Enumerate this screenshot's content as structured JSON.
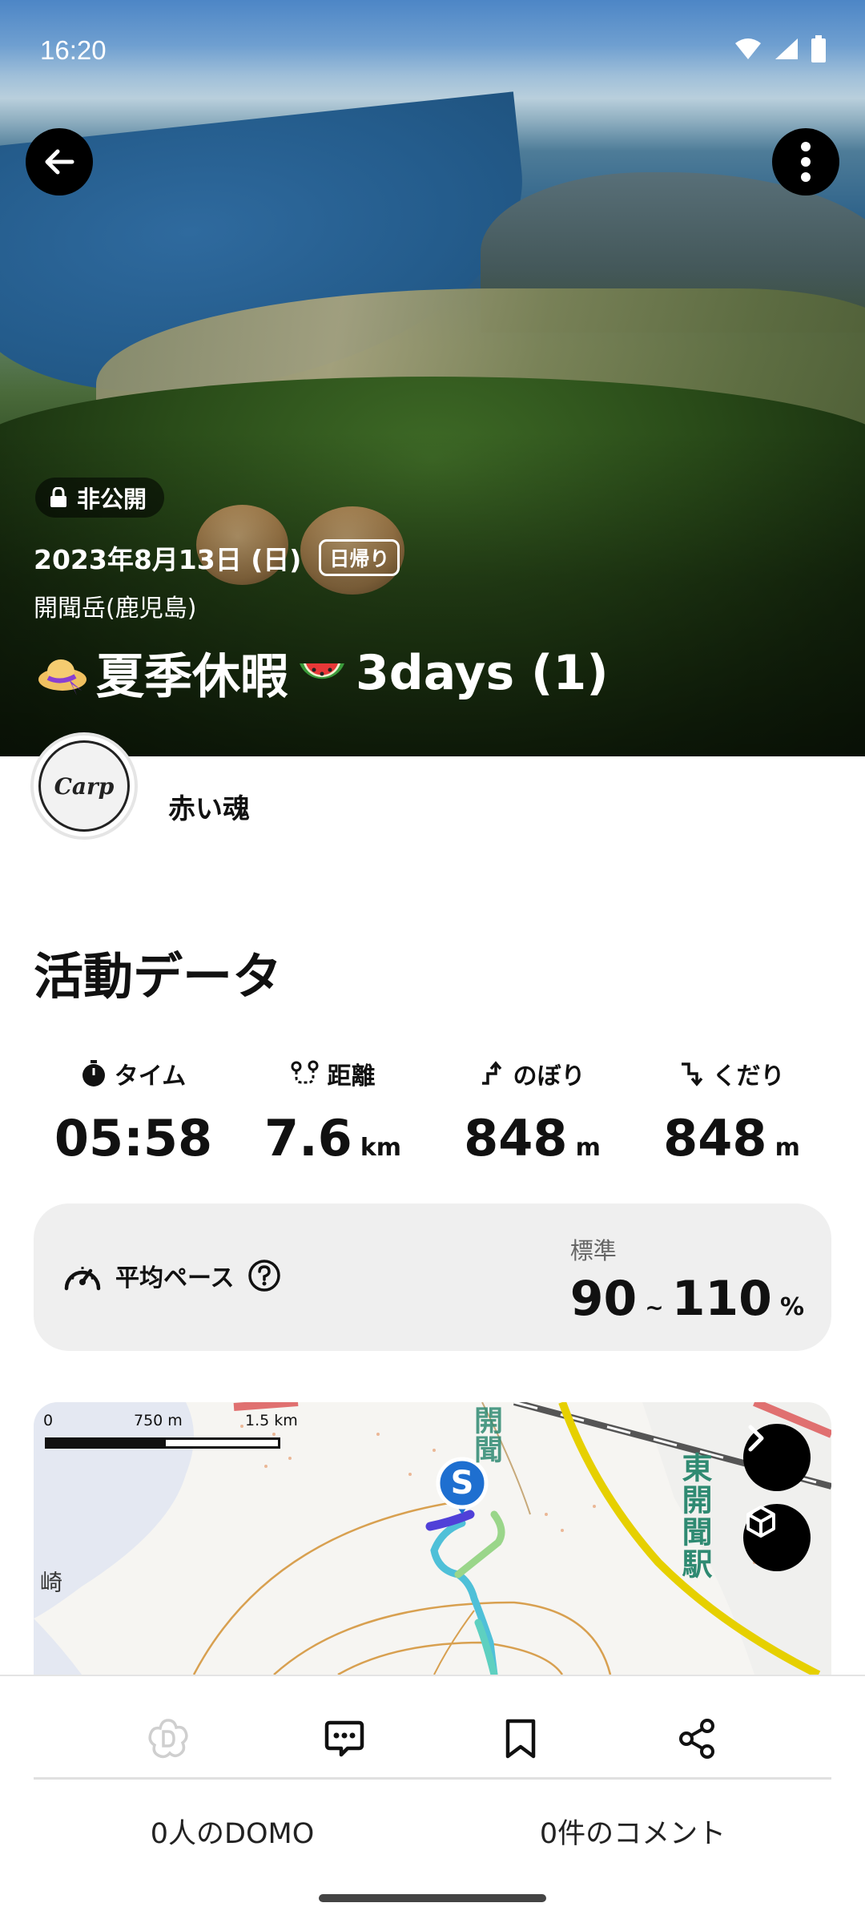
{
  "status_bar": {
    "time": "16:20"
  },
  "hero": {
    "privacy": "非公開",
    "date": "2023年8月13日 (日)",
    "trip_type": "日帰り",
    "location": "開聞岳(鹿児島)",
    "title": "夏季休暇",
    "title_suffix": "3days (1)",
    "title_icons": [
      "straw-hat-emoji",
      "watermelon-emoji"
    ]
  },
  "user": {
    "name": "赤い魂",
    "avatar_text": "Carp"
  },
  "activity": {
    "heading": "活動データ",
    "stats": [
      {
        "label": "タイム",
        "value": "05:58",
        "unit": "",
        "icon": "stopwatch-icon"
      },
      {
        "label": "距離",
        "value": "7.6",
        "unit": "km",
        "icon": "route-icon"
      },
      {
        "label": "のぼり",
        "value": "848",
        "unit": "m",
        "icon": "ascent-icon"
      },
      {
        "label": "くだり",
        "value": "848",
        "unit": "m",
        "icon": "descent-icon"
      }
    ],
    "pace": {
      "label": "平均ペース",
      "rating": "標準",
      "min": "90",
      "separator": "~",
      "max": "110",
      "unit": "%"
    }
  },
  "map": {
    "scale": [
      "0",
      "750 m",
      "1.5 km"
    ],
    "station": "東開聞駅",
    "road_label": "開聞",
    "fragment": "崎",
    "start_marker": "S"
  },
  "bottom": {
    "domo_count": "0人のDOMO",
    "comment_count": "0件のコメント"
  },
  "colors": {
    "accent_blue": "#1e6fd0",
    "station_green": "#2f8a72",
    "road_yellow": "#e6d000",
    "railway_red": "#e07070"
  }
}
